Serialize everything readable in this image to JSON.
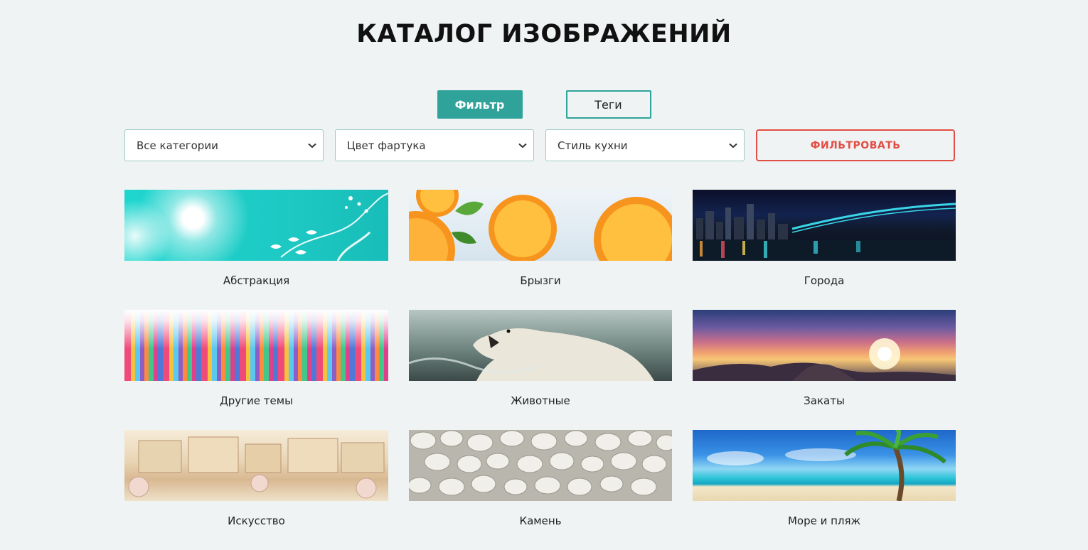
{
  "page": {
    "title": "КАТАЛОГ ИЗОБРАЖЕНИЙ"
  },
  "tabs": [
    {
      "label": "Фильтр",
      "active": true
    },
    {
      "label": "Теги",
      "active": false
    }
  ],
  "filters": {
    "category": {
      "selected": "Все категории"
    },
    "apron_color": {
      "selected": "Цвет фартука"
    },
    "kitchen_style": {
      "selected": "Стиль кухни"
    },
    "submit_label": "ФИЛЬТРОВАТЬ"
  },
  "colors": {
    "accent": "#2fa39a",
    "danger": "#e24d44",
    "background": "#eff3f3"
  },
  "catalog": [
    {
      "label": "Абстракция",
      "image": "abstract-turquoise"
    },
    {
      "label": "Брызги",
      "image": "orange-splash"
    },
    {
      "label": "Города",
      "image": "night-city-bridge"
    },
    {
      "label": "Другие темы",
      "image": "colorful-stripes"
    },
    {
      "label": "Животные",
      "image": "polar-bear"
    },
    {
      "label": "Закаты",
      "image": "sunset-mountains"
    },
    {
      "label": "Искусство",
      "image": "venice-drawing"
    },
    {
      "label": "Камень",
      "image": "white-pebbles"
    },
    {
      "label": "Море и пляж",
      "image": "tropical-beach"
    }
  ]
}
